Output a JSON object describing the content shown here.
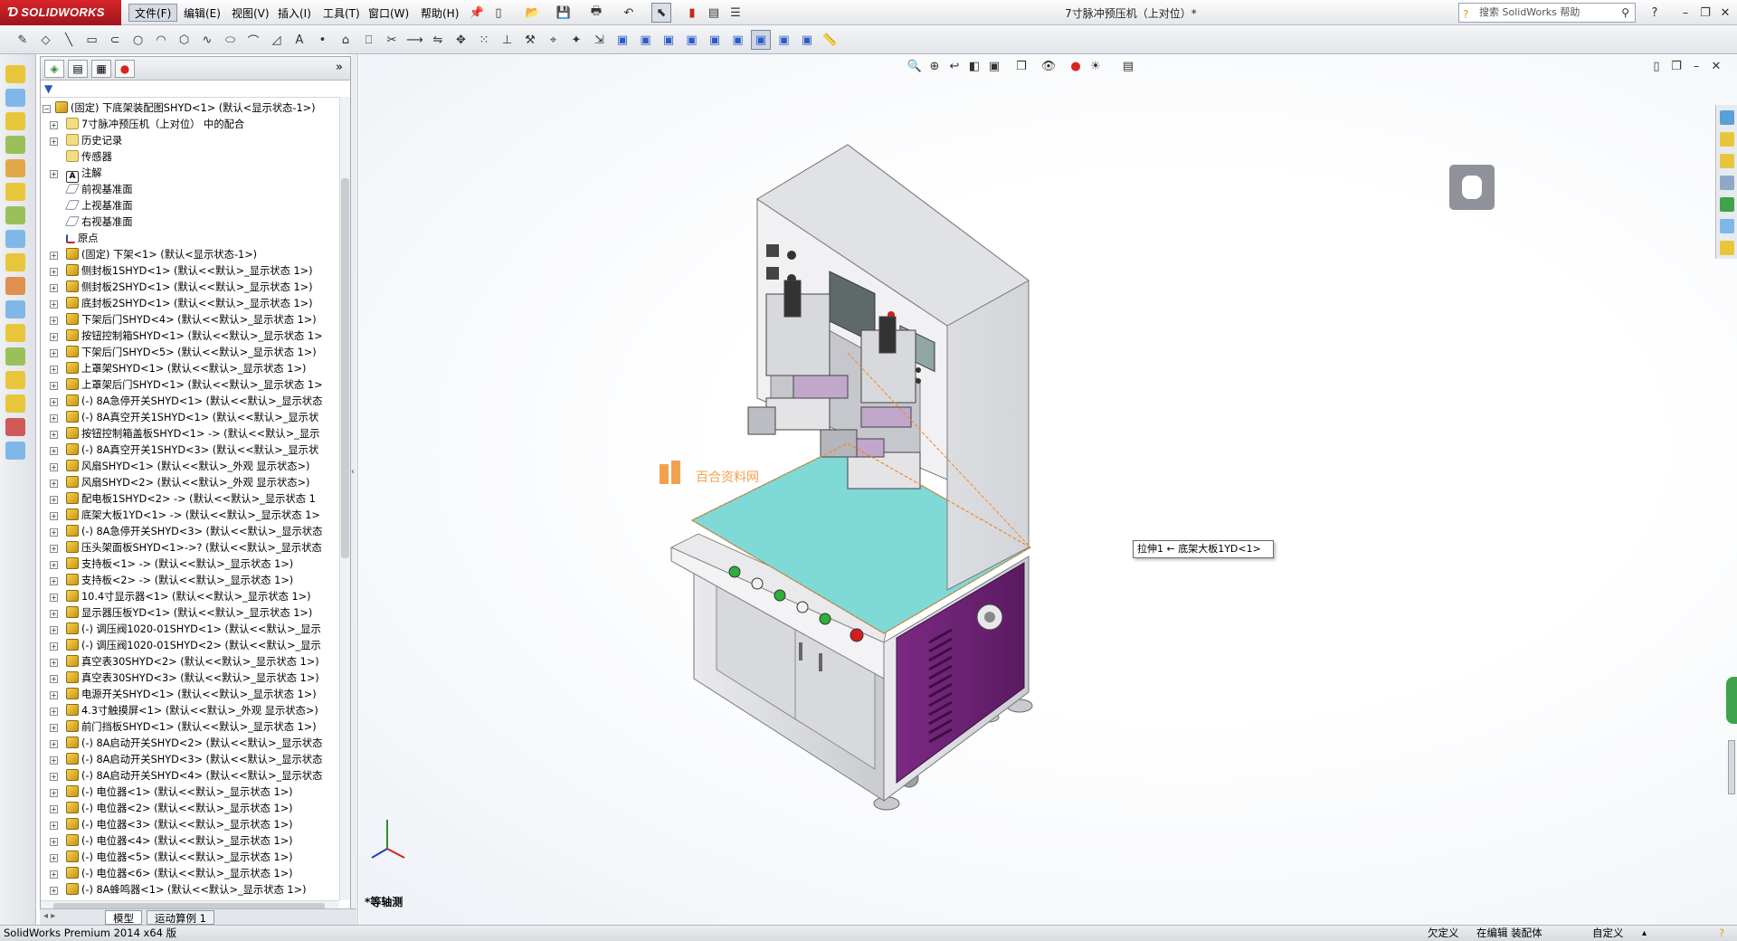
{
  "app": {
    "logo": "SOLIDWORKS",
    "title": "7寸脉冲预压机（上对位）*"
  },
  "menu": [
    "文件(F)",
    "编辑(E)",
    "视图(V)",
    "插入(I)",
    "工具(T)",
    "窗口(W)",
    "帮助(H)"
  ],
  "help_search": {
    "placeholder": "搜索 SolidWorks 帮助"
  },
  "tree": {
    "root": "(固定) 下底架装配图SHYD<1> (默认<显示状态-1>)",
    "items": [
      {
        "icon": "fold",
        "text": "7寸脉冲预压机（上对位） 中的配合",
        "exp": true
      },
      {
        "icon": "fold",
        "text": "历史记录",
        "exp": true
      },
      {
        "icon": "fold",
        "text": "传感器",
        "exp": false
      },
      {
        "icon": "note",
        "text": "注解",
        "exp": true
      },
      {
        "icon": "plane",
        "text": "前视基准面",
        "exp": false
      },
      {
        "icon": "plane",
        "text": "上视基准面",
        "exp": false
      },
      {
        "icon": "plane",
        "text": "右视基准面",
        "exp": false
      },
      {
        "icon": "orig",
        "text": "原点",
        "exp": false
      },
      {
        "icon": "asm",
        "text": "(固定) 下架<1> (默认<显示状态-1>)",
        "exp": true
      },
      {
        "icon": "asm",
        "text": "侧封板1SHYD<1> (默认<<默认>_显示状态 1>)",
        "exp": true
      },
      {
        "icon": "asm",
        "text": "侧封板2SHYD<1> (默认<<默认>_显示状态 1>)",
        "exp": true
      },
      {
        "icon": "asm",
        "text": "底封板2SHYD<1> (默认<<默认>_显示状态 1>)",
        "exp": true
      },
      {
        "icon": "asm",
        "text": "下架后门SHYD<4> (默认<<默认>_显示状态 1>)",
        "exp": true
      },
      {
        "icon": "asm",
        "text": "按钮控制箱SHYD<1> (默认<<默认>_显示状态 1>",
        "exp": true
      },
      {
        "icon": "asm",
        "text": "下架后门SHYD<5> (默认<<默认>_显示状态 1>)",
        "exp": true
      },
      {
        "icon": "asm",
        "text": "上罩架SHYD<1> (默认<<默认>_显示状态 1>)",
        "exp": true
      },
      {
        "icon": "asm",
        "text": "上罩架后门SHYD<1> (默认<<默认>_显示状态 1>",
        "exp": true
      },
      {
        "icon": "asm",
        "text": "(-) 8A急停开关SHYD<1> (默认<<默认>_显示状态",
        "exp": true
      },
      {
        "icon": "asm",
        "text": "(-) 8A真空开关1SHYD<1> (默认<<默认>_显示状",
        "exp": true
      },
      {
        "icon": "asm",
        "text": "按钮控制箱盖板SHYD<1> -> (默认<<默认>_显示",
        "exp": true
      },
      {
        "icon": "asm",
        "text": "(-) 8A真空开关1SHYD<3> (默认<<默认>_显示状",
        "exp": true
      },
      {
        "icon": "asm",
        "text": "风扇SHYD<1> (默认<<默认>_外观 显示状态>)",
        "exp": true
      },
      {
        "icon": "asm",
        "text": "风扇SHYD<2> (默认<<默认>_外观 显示状态>)",
        "exp": true
      },
      {
        "icon": "asm",
        "text": "配电板1SHYD<2> -> (默认<<默认>_显示状态 1",
        "exp": true
      },
      {
        "icon": "asm",
        "text": "底架大板1YD<1> -> (默认<<默认>_显示状态 1>",
        "exp": true
      },
      {
        "icon": "asm",
        "text": "(-) 8A急停开关SHYD<3> (默认<<默认>_显示状态",
        "exp": true
      },
      {
        "icon": "asm",
        "text": "压头架面板SHYD<1>->? (默认<<默认>_显示状态",
        "exp": true
      },
      {
        "icon": "asm",
        "text": "支持板<1> -> (默认<<默认>_显示状态 1>)",
        "exp": true
      },
      {
        "icon": "asm",
        "text": "支持板<2> -> (默认<<默认>_显示状态 1>)",
        "exp": true
      },
      {
        "icon": "asm",
        "text": "10.4寸显示器<1> (默认<<默认>_显示状态 1>)",
        "exp": true
      },
      {
        "icon": "asm",
        "text": "显示器压板YD<1> (默认<<默认>_显示状态 1>)",
        "exp": true
      },
      {
        "icon": "asm",
        "text": "(-) 调压阀1020-01SHYD<1> (默认<<默认>_显示",
        "exp": true
      },
      {
        "icon": "asm",
        "text": "(-) 调压阀1020-01SHYD<2> (默认<<默认>_显示",
        "exp": true
      },
      {
        "icon": "asm",
        "text": "真空表30SHYD<2> (默认<<默认>_显示状态 1>)",
        "exp": true
      },
      {
        "icon": "asm",
        "text": "真空表30SHYD<3> (默认<<默认>_显示状态 1>)",
        "exp": true
      },
      {
        "icon": "asm",
        "text": "电源开关SHYD<1> (默认<<默认>_显示状态 1>)",
        "exp": true
      },
      {
        "icon": "asm",
        "text": "4.3寸触摸屏<1> (默认<<默认>_外观 显示状态>)",
        "exp": true
      },
      {
        "icon": "asm",
        "text": "前门挡板SHYD<1> (默认<<默认>_显示状态 1>)",
        "exp": true
      },
      {
        "icon": "asm",
        "text": "(-) 8A启动开关SHYD<2> (默认<<默认>_显示状态",
        "exp": true
      },
      {
        "icon": "asm",
        "text": "(-) 8A启动开关SHYD<3> (默认<<默认>_显示状态",
        "exp": true
      },
      {
        "icon": "asm",
        "text": "(-) 8A启动开关SHYD<4> (默认<<默认>_显示状态",
        "exp": true
      },
      {
        "icon": "asm",
        "text": "(-) 电位器<1> (默认<<默认>_显示状态 1>)",
        "exp": true
      },
      {
        "icon": "asm",
        "text": "(-) 电位器<2> (默认<<默认>_显示状态 1>)",
        "exp": true
      },
      {
        "icon": "asm",
        "text": "(-) 电位器<3> (默认<<默认>_显示状态 1>)",
        "exp": true
      },
      {
        "icon": "asm",
        "text": "(-) 电位器<4> (默认<<默认>_显示状态 1>)",
        "exp": true
      },
      {
        "icon": "asm",
        "text": "(-) 电位器<5> (默认<<默认>_显示状态 1>)",
        "exp": true
      },
      {
        "icon": "asm",
        "text": "(-) 电位器<6> (默认<<默认>_显示状态 1>)",
        "exp": true
      },
      {
        "icon": "asm",
        "text": "(-) 8A蜂鸣器<1> (默认<<默认>_显示状态 1>)",
        "exp": true
      }
    ]
  },
  "viewport": {
    "tooltip": "拉伸1 ← 底架大板1YD<1>",
    "view_label": "*等轴测",
    "watermark": "百合资料网"
  },
  "bottom_tabs": [
    "模型",
    "运动算例 1"
  ],
  "status": {
    "product": "SolidWorks Premium 2014 x64 版",
    "defined": "欠定义",
    "editing": "在编辑 装配体",
    "custom": "自定义"
  },
  "colors": {
    "accent": "#c8222a",
    "table": "#7fd9d7",
    "cabinet": "#6a2470",
    "frame": "#dedfe3"
  }
}
